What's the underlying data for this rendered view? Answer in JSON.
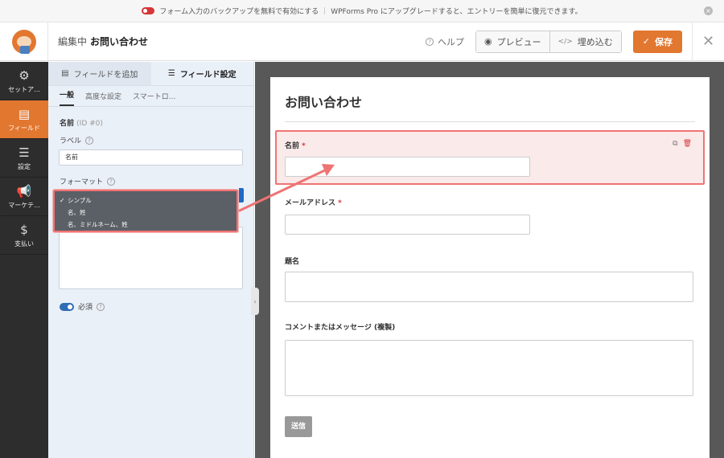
{
  "notice": {
    "text1": "フォーム入力のバックアップを無料で有効にする",
    "separator": "|",
    "text2": "WPForms Pro にアップグレードすると、エントリーを簡単に復元できます。",
    "close_icon": "×"
  },
  "header": {
    "editing_label": "編集中",
    "form_name": "お問い合わせ",
    "help_label": "ヘルプ",
    "preview_label": "プレビュー",
    "embed_label": "埋め込む",
    "save_label": "保存",
    "close_icon": "✕",
    "accent_color": "#e27730"
  },
  "sidenav": {
    "items": [
      {
        "label": "セットア...",
        "icon": "⚙"
      },
      {
        "label": "フィールド",
        "icon": "▤"
      },
      {
        "label": "設定",
        "icon": "☰"
      },
      {
        "label": "マーケテ...",
        "icon": "📢"
      },
      {
        "label": "支払い",
        "icon": "$"
      }
    ]
  },
  "panel": {
    "tabs": [
      {
        "label": "フィールドを追加",
        "icon": "▤"
      },
      {
        "label": "フィールド設定",
        "icon": "☰"
      }
    ],
    "subtabs": [
      "一般",
      "高度な設定",
      "スマートロ..."
    ],
    "field_title": "名前",
    "field_id": "(ID #0)",
    "label_caption": "ラベル",
    "label_value": "名前",
    "format_caption": "フォーマット",
    "required_label": "必須",
    "format_options": [
      "シンプル",
      "名、姓",
      "名、ミドルネーム、姓"
    ]
  },
  "form": {
    "title": "お問い合わせ",
    "fields": [
      {
        "label": "名前",
        "required": "*"
      },
      {
        "label": "メールアドレス",
        "required": "*"
      },
      {
        "label": "題名",
        "required": ""
      },
      {
        "label": "コメントまたはメッセージ (複製)",
        "required": ""
      }
    ],
    "submit_label": "送信"
  }
}
